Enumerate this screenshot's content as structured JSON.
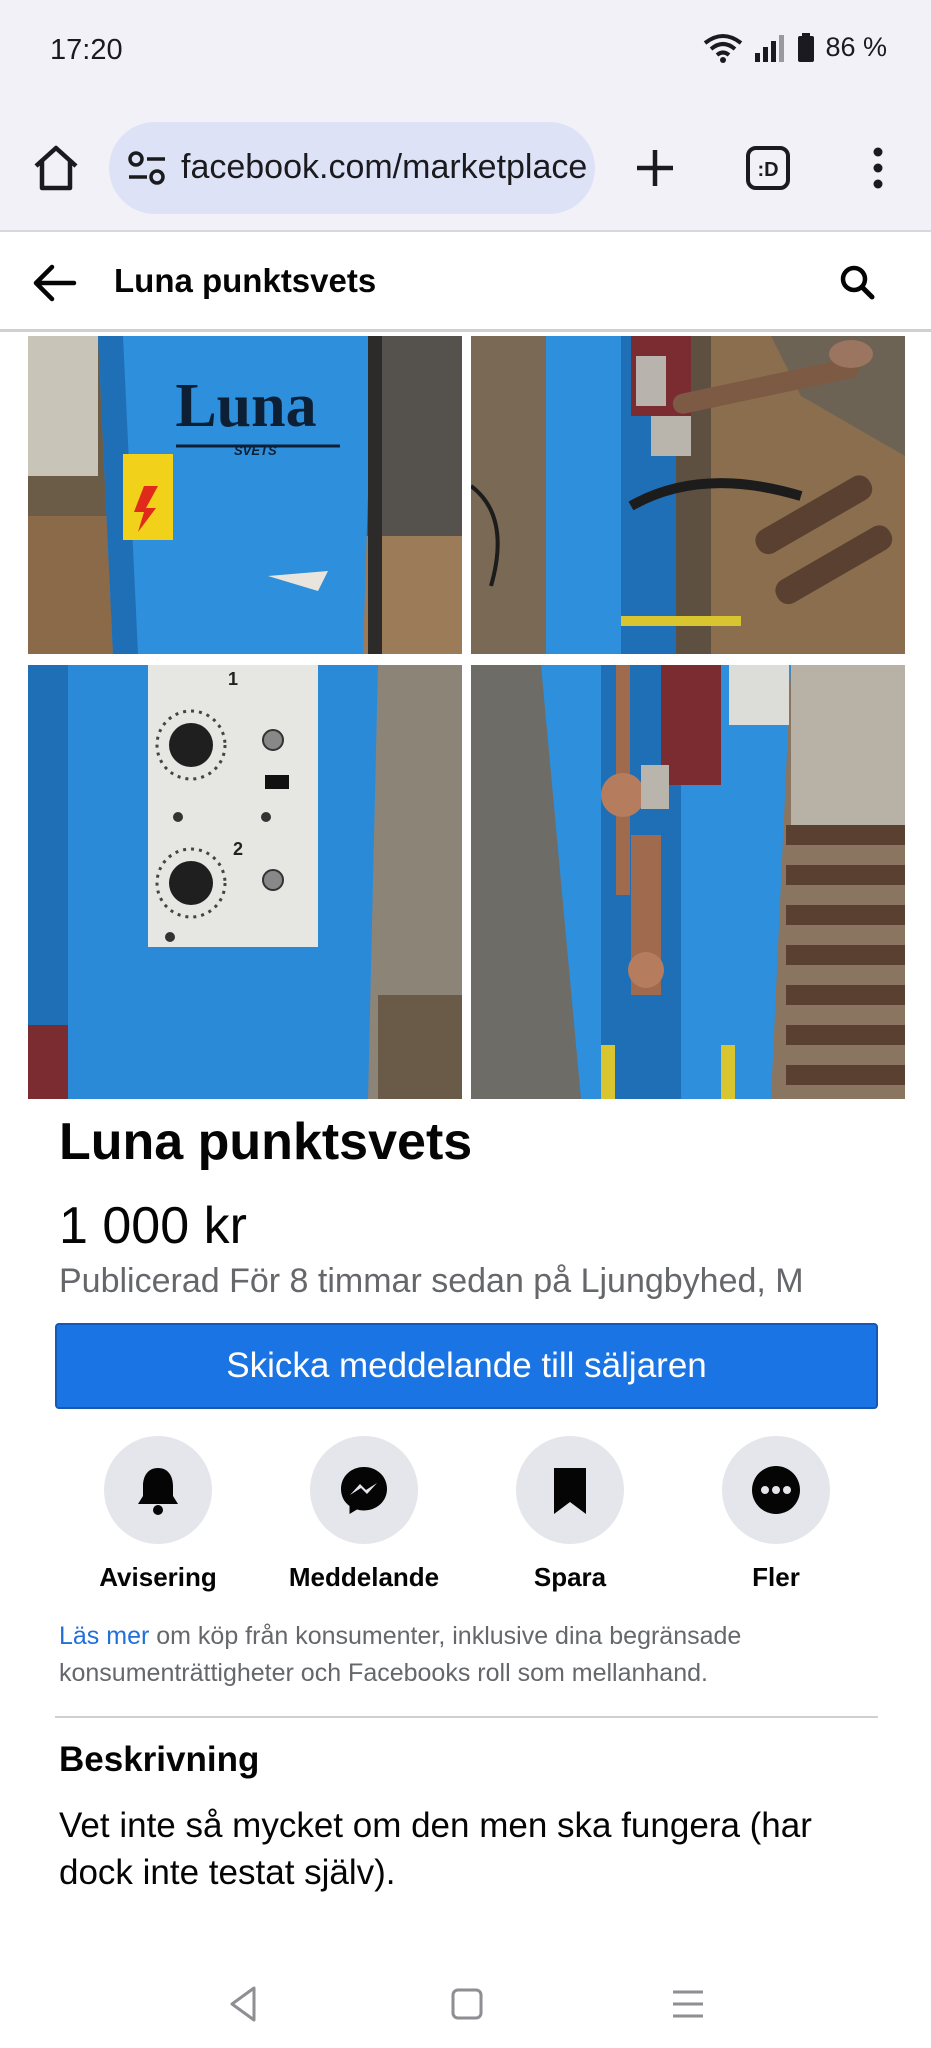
{
  "status": {
    "time": "17:20",
    "battery": "86 %"
  },
  "browser": {
    "url": "facebook.com/marketplace"
  },
  "header": {
    "title": "Luna punktsvets"
  },
  "listing": {
    "title": "Luna punktsvets",
    "price": "1 000 kr",
    "meta": "Publicerad För 8 timmar sedan på Ljungbyhed, M",
    "photo1_logo": "Luna",
    "photo1_sublogo": "SVETS",
    "photo3_label1": "1",
    "photo3_label2": "2"
  },
  "send_button": {
    "label": "Skicka meddelande till säljaren"
  },
  "actions": [
    {
      "label": "Avisering",
      "icon": "bell-icon"
    },
    {
      "label": "Meddelande",
      "icon": "messenger-icon"
    },
    {
      "label": "Spara",
      "icon": "bookmark-icon"
    },
    {
      "label": "Fler",
      "icon": "more-icon"
    }
  ],
  "info": {
    "link": "Läs mer",
    "text": " om köp från konsumenter, inklusive dina begränsade konsumenträttigheter och Facebooks roll som mellanhand."
  },
  "description": {
    "heading": "Beskrivning",
    "text": "Vet inte så mycket om den men ska fungera (har dock inte testat själv)."
  }
}
